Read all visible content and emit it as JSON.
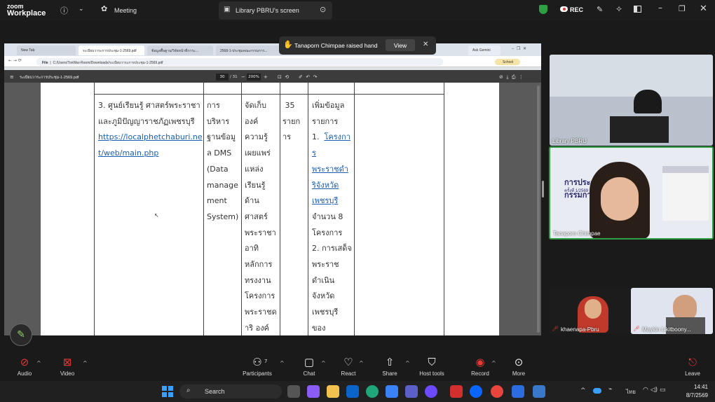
{
  "topbar": {
    "logo_top": "zoom",
    "logo_bottom": "Workplace",
    "meeting_label": "Meeting",
    "share_title": "Library PBRU's screen",
    "rec_label": "REC",
    "colors": {
      "rec": "#e53935",
      "shield": "#2ea043"
    }
  },
  "notification": {
    "text": "Tanaporn Chimpae raised hand",
    "view_label": "View"
  },
  "browser": {
    "tabs": [
      "New Tab",
      "ระเบียบวาระการประชุม-1-2569.pdf",
      "ข้อมูลพื้นฐาน/วิจัยหน้าที่ภาระ...",
      "2568-1-ประชุมคณะกรรมการ...",
      "Ask Gemini"
    ],
    "address": "C:/Users/TonWar-Room/Downloads/ระเบียบวาระการประชุม-1-2569.pdf",
    "file_label": "File",
    "profile": "School"
  },
  "pdf": {
    "filename": "ระเบียบวาระการประชุม-1-2569.pdf",
    "page_current": "30",
    "page_total": "/ 31",
    "zoom": "200%"
  },
  "table": {
    "col1": [
      "3. ศูนย์เรียนรู้ ศาสตร์พระราชา",
      "และภูมิปัญญาราชภัฏเพชรบุรี"
    ],
    "col1_link": [
      "https://localphetchaburi.ne",
      "t/web/main.php"
    ],
    "col2": [
      "การ",
      "บริหาร",
      "ฐานข้อมู",
      "ล DMS",
      "(Data",
      "manage",
      "ment",
      "System)"
    ],
    "col3": [
      "จัดเก็บ",
      "องค์",
      "ความรู้",
      "เผยแพร่",
      "แหล่ง",
      "เรียนรู้",
      "ด้าน",
      "ศาสตร์",
      "พระราชา",
      "อาทิ",
      "หลักการ",
      "ทรงงาน",
      "โครงการ",
      "พระราชด",
      "าริ องค์"
    ],
    "col4": [
      " 35",
      "รายก",
      "าร"
    ],
    "col5_top": [
      "เพิ่มข้อมูล",
      "รายการ",
      "1.  "
    ],
    "col5_link": [
      "โครงกา",
      "ร",
      "พระราชดำ",
      "ริจังหวัด",
      "เพชรบุรี"
    ],
    "col5_bottom": [
      "จำนวน 8",
      "โครงการ",
      "2. การเสด็จ",
      "พระราช",
      "ดำเนิน",
      "จังหวัด",
      "เพชรบุรี",
      "ของ"
    ]
  },
  "videos": {
    "library": "Library PBRU",
    "tanaporn": "Tanaporn Chimpae",
    "slide_title": "การประชุมคณะกรรมการประจำ",
    "slide_sub": "ครั้งที่ 1/2569",
    "khaenapa": "khaenapa-Pbru",
    "maykin": "Maykin Likitboony..."
  },
  "toolbar": {
    "audio": "Audio",
    "video": "Video",
    "participants": "Participants",
    "participants_count": "7",
    "chat": "Chat",
    "react": "React",
    "share": "Share",
    "host_tools": "Host tools",
    "record": "Record",
    "more": "More",
    "leave": "Leave"
  },
  "taskbar": {
    "search": "Search",
    "lang": "ไทย",
    "time": "14:41",
    "date": "8/7/2569"
  }
}
